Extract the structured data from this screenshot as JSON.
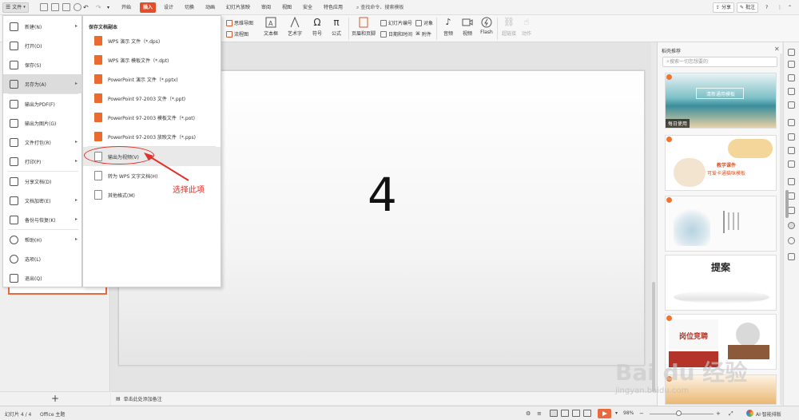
{
  "titlebar": {
    "file_label": "文件",
    "tabs": [
      "开始",
      "插入",
      "设计",
      "切换",
      "动画",
      "幻灯片放映",
      "审阅",
      "视图",
      "安全",
      "特色应用"
    ],
    "active_tab": "插入",
    "search_command": "查找命令、搜索模板",
    "share_label": "分享",
    "comment_label": "批注"
  },
  "ribbon": {
    "mind_map": "思维导图",
    "flowchart": "流程图",
    "textbox": "文本框",
    "art_text": "艺术字",
    "symbol": "符号",
    "formula": "公式",
    "header_footer": "页眉和页脚",
    "slide_number": "幻灯片编号",
    "object": "对象",
    "date_time": "日期和时间",
    "attachment": "附件",
    "audio": "音频",
    "video": "视频",
    "flash": "Flash",
    "hyperlink": "超链接",
    "action": "动作"
  },
  "file_menu": {
    "items": [
      {
        "label": "新建(N)",
        "icon": "new-file-icon",
        "arrow": true
      },
      {
        "label": "打开(O)",
        "icon": "open-folder-icon",
        "arrow": false
      },
      {
        "label": "保存(S)",
        "icon": "save-icon",
        "arrow": false
      },
      {
        "label": "另存为(A)",
        "icon": "save-as-icon",
        "arrow": true
      },
      {
        "label": "输出为PDF(F)",
        "icon": "pdf-icon",
        "arrow": false
      },
      {
        "label": "输出为图片(G)",
        "icon": "image-icon",
        "arrow": false
      },
      {
        "label": "文件打包(R)",
        "icon": "package-icon",
        "arrow": true
      },
      {
        "label": "打印(P)",
        "icon": "print-icon",
        "arrow": true
      },
      {
        "label": "分享文档(D)",
        "icon": "share-icon",
        "arrow": false
      },
      {
        "label": "文档加密(E)",
        "icon": "lock-icon",
        "arrow": true
      },
      {
        "label": "备份与恢复(K)",
        "icon": "backup-icon",
        "arrow": true
      },
      {
        "label": "帮助(H)",
        "icon": "help-icon",
        "arrow": true
      },
      {
        "label": "选项(L)",
        "icon": "gear-icon",
        "arrow": false
      },
      {
        "label": "退出(Q)",
        "icon": "exit-icon",
        "arrow": false
      }
    ]
  },
  "save_as_submenu": {
    "title": "保存文档副本",
    "items": [
      {
        "label": "WPS 演示 文件（*.dps)"
      },
      {
        "label": "WPS 演示 模板文件（*.dpt)"
      },
      {
        "label": "PowerPoint 演示 文件（*.pptx)"
      },
      {
        "label": "PowerPoint 97-2003 文件（*.ppt)"
      },
      {
        "label": "PowerPoint 97-2003 模板文件（*.pot)"
      },
      {
        "label": "PowerPoint 97-2003 放映文件（*.pps)"
      },
      {
        "label": "输出为视频(V)"
      },
      {
        "label": "转为 WPS 文字文档(H)"
      },
      {
        "label": "其他格式(M)"
      }
    ]
  },
  "annotation": {
    "text": "选择此项",
    "color": "#e0322a"
  },
  "slide": {
    "number_text": "4"
  },
  "notes": {
    "placeholder": "单击此处添加备注"
  },
  "left_pane": {
    "add_symbol": "+"
  },
  "right_panel": {
    "title": "稻壳推荐",
    "search_placeholder": "搜索一切您想要的",
    "template_badge": "每日使用",
    "template1_title": "清新通用模板",
    "template2_title1": "教学课件",
    "template2_title2": "可爱卡通猫咪模板",
    "template4_title": "提案",
    "template5_title": "岗位竞聘"
  },
  "statusbar": {
    "slide_info": "幻灯片 4 / 4",
    "theme": "Office 主题",
    "zoom": "98%",
    "ai_label": "AI·智能排版"
  },
  "watermark": {
    "text": "Bai du 经验",
    "url": "jingyan.baidu.com"
  },
  "colors": {
    "accent": "#e34d2a",
    "menu_icon_orange": "#ea6b2f",
    "annotation_red": "#e0322a"
  }
}
